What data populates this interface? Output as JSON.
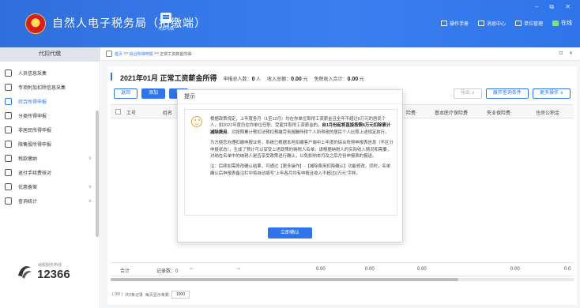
{
  "header": {
    "app_title": "自然人电子税务局（扣缴端）",
    "proxy_label": "代扣代缴",
    "nav": [
      "操作手册",
      "消息中心",
      "单位管理"
    ],
    "online": "在线",
    "window_controls": "– ⧉ ✕"
  },
  "sidebar": {
    "heading": "代扣代缴",
    "items": [
      {
        "label": "人员信息采集"
      },
      {
        "label": "专项附加扣除信息采集"
      },
      {
        "label": "综合所得申报"
      },
      {
        "label": "分类所得申报"
      },
      {
        "label": "非居民所得申报"
      },
      {
        "label": "限售股所得申报"
      },
      {
        "label": "税款缴纳"
      },
      {
        "label": "退付手续费核对"
      },
      {
        "label": "优惠备案"
      },
      {
        "label": "查询统计"
      }
    ],
    "footer_small": "纳税服务热线",
    "footer_number": "12366"
  },
  "breadcrumb": {
    "home": "首页",
    "sep1": ">>",
    "link": "综合所得申报",
    "sep2": ">>",
    "current": "正常工资薪金所得",
    "tools": "⊡ ✕"
  },
  "main": {
    "title": "2021年01月 正常工资薪金所得",
    "stats": {
      "declared_label": "申报总人数：",
      "declared_value": "0",
      "declared_unit": "人",
      "income_label": "收入总额：",
      "income_value": "0.00",
      "income_unit": "元",
      "exempt_label": "免税收入合计：",
      "exempt_value": "0.00",
      "exempt_unit": "元"
    },
    "toolbar": {
      "back": "返回",
      "add": "添加",
      "import": "导"
    },
    "toolbar_right": {
      "export": "导出 ∨",
      "filter": "展开查询条件",
      "more": "更多操作 ∨"
    },
    "columns": [
      "工号",
      "姓名",
      "险费",
      "基本医疗保险费",
      "失业保险费",
      "住房公积金"
    ],
    "totals": {
      "label": "合计",
      "count": "记录数：0",
      "dash1": "--",
      "dash2": "--",
      "v1": "0.00",
      "v2": "0.00",
      "v3": "0.00",
      "v4": "0.00",
      "v5": "0.0"
    },
    "pager": {
      "pages": "( 0/0 )",
      "total": "共0条记录",
      "page_size_label": "每页显示条数",
      "page_size": "1000"
    }
  },
  "dialog": {
    "title": "提示",
    "p1_a": "根据政策规定，上年度各月（1至12月）均在你单位取得工资薪金且全年不超过6万元的居民个人，如2021年度仍在你单位任职、受雇并取得工资薪金的，",
    "p1_b": "自1月份起将直接按照6万元扣除累计减除费用",
    "p1_c": "。对按照累计预扣法预扣预缴劳务报酬所得个人所得税的居民个人比照上述规定执行。",
    "p2": "为方便您办理扣缴申报业务，系统已根据本地扣缴客户端中上年度的综合所得申报表信息（不区分申报状态），生成了预计可以享受上述政策的纳税人名单。请根据纳税人的实际收入情况和需要，对纳在名单中的纳税人是否享受政策进行确认，以免影响本月及之后月份申报表的报送。",
    "p3": "注：后续如需修改确认结果，可通过【更多操作】-【减除费用扣除确认】功能修改。同时，名单确认后申报表备注栏中将自动填写“上年各月均有申报且收入不超过6万元”字样。",
    "confirm": "立即确认"
  }
}
